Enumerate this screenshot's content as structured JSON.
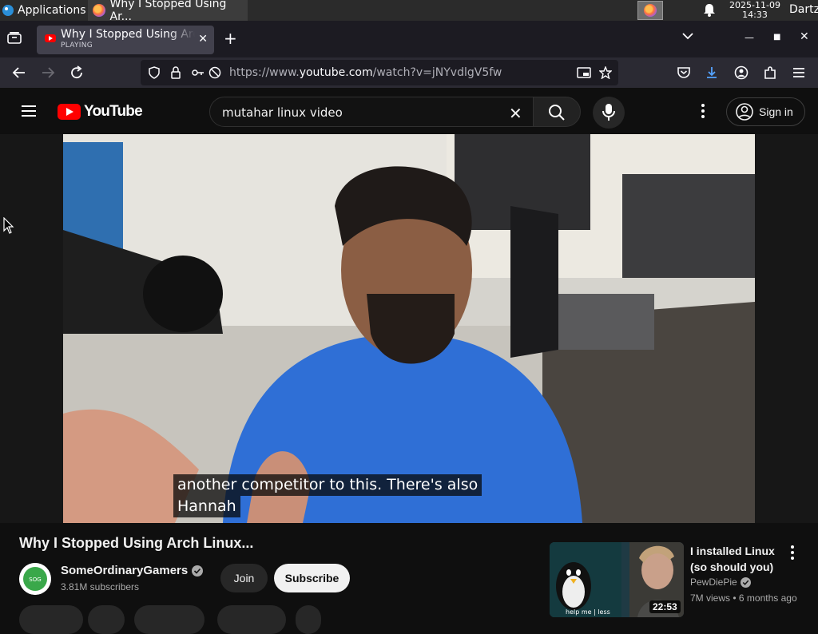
{
  "taskbar": {
    "applications_label": "Applications",
    "window_title": "Why I Stopped Using Ar...",
    "clock_date": "2025-11-09",
    "clock_time": "14:33",
    "user": "Dartz"
  },
  "browser": {
    "tab_title": "Why I Stopped Using Arch Linux...",
    "tab_status": "PLAYING",
    "url_prefix": "https://www.",
    "url_domain": "youtube.com",
    "url_path": "/watch?v=jNYvdlgV5fw"
  },
  "youtube": {
    "logo_text": "YouTube",
    "search_value": "mutahar linux video",
    "signin_label": "Sign in"
  },
  "video": {
    "caption_line1": "another competitor to this. There's also",
    "caption_line2": "Hannah",
    "title": "Why I Stopped Using Arch Linux...",
    "channel_name": "SomeOrdinaryGamers",
    "channel_subs": "3.81M subscribers",
    "join_label": "Join",
    "subscribe_label": "Subscribe"
  },
  "recommended": {
    "title": "I installed Linux (so should you)",
    "channel": "PewDiePie",
    "views": "7M views",
    "age": "6 months ago",
    "duration": "22:53",
    "thumb_text": "help me | less"
  },
  "colors": {
    "yt_red": "#ff0000",
    "bg": "#0f0f0f",
    "browser_chrome": "#2b2a33"
  }
}
